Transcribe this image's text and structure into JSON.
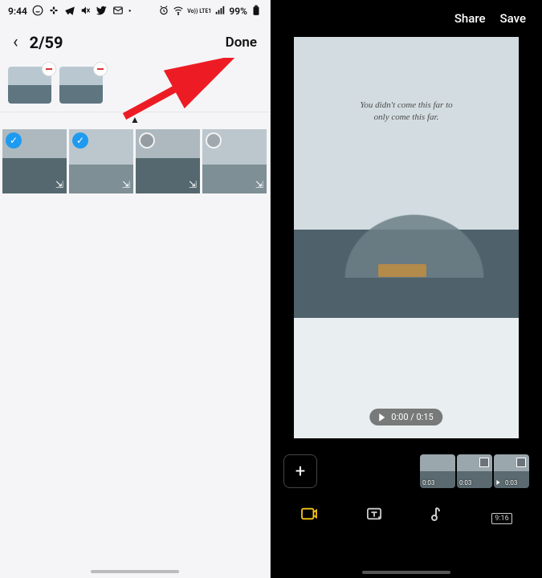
{
  "status": {
    "time": "9:44",
    "battery_pct": "99%",
    "lte_label": "Vo)) LTE1"
  },
  "left": {
    "counter": "2/59",
    "done_label": "Done",
    "selected": [
      {
        "id": "sel-1"
      },
      {
        "id": "sel-2"
      }
    ],
    "grid": [
      {
        "checked": true
      },
      {
        "checked": true
      },
      {
        "checked": false
      },
      {
        "checked": false
      }
    ]
  },
  "right": {
    "share_label": "Share",
    "save_label": "Save",
    "quote_line1": "You didn't come this far to",
    "quote_line2": "only come this far.",
    "play_time": "0:00 / 0:15",
    "clips": [
      {
        "time": "0:03"
      },
      {
        "time": "0:03"
      },
      {
        "time": "0:03"
      }
    ],
    "aspect_label": "9:16"
  }
}
